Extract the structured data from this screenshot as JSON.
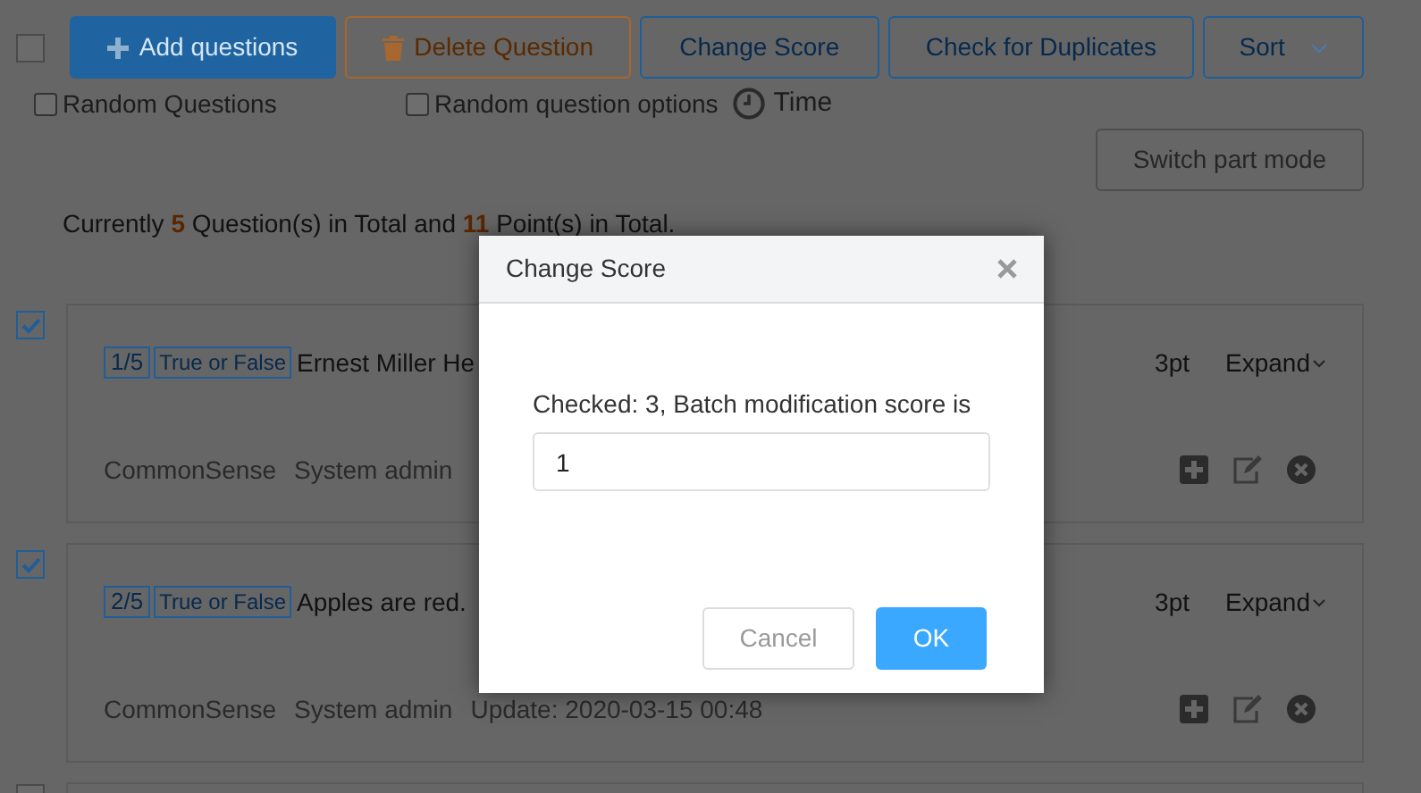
{
  "toolbar": {
    "select_all": {
      "checked": false
    },
    "buttons": [
      {
        "kind": "add",
        "label": "Add questions"
      },
      {
        "kind": "delete",
        "label": "Delete Question"
      },
      {
        "kind": "plain",
        "label": "Change Score"
      },
      {
        "kind": "plain",
        "label": "Check for Duplicates"
      },
      {
        "kind": "sort",
        "label": "Sort"
      }
    ],
    "options": [
      {
        "kind": "checkbox",
        "label": "Random Questions",
        "checked": false
      },
      {
        "kind": "checkbox",
        "label": "Random question options",
        "checked": false
      },
      {
        "kind": "clock",
        "label": "Time"
      }
    ],
    "switch_button": "Switch part mode"
  },
  "summary": [
    {
      "text": "Currently ",
      "highlight": false
    },
    {
      "text": "5",
      "highlight": true
    },
    {
      "text": " Question(s) in Total and ",
      "highlight": false
    },
    {
      "text": "11",
      "highlight": true
    },
    {
      "text": " Point(s) in Total.",
      "highlight": false
    }
  ],
  "questions": [
    {
      "checked": true,
      "index": "1/5",
      "type": "True or False",
      "title": "Ernest Miller He",
      "category": "CommonSense",
      "author": "System admin",
      "score": "3pt",
      "expand": "Expand"
    },
    {
      "checked": true,
      "index": "2/5",
      "type": "True or False",
      "title": "Apples are red.",
      "category": "CommonSense",
      "author": "System admin",
      "update": "Update: 2020-03-15 00:48",
      "score": "3pt",
      "expand": "Expand"
    },
    {
      "checked": false
    }
  ],
  "dialog": {
    "title": "Change Score",
    "label": "Checked: 3, Batch modification score is",
    "value": "1",
    "buttons": [
      {
        "kind": "cancel",
        "label": "Cancel"
      },
      {
        "kind": "ok",
        "label": "OK"
      }
    ]
  }
}
